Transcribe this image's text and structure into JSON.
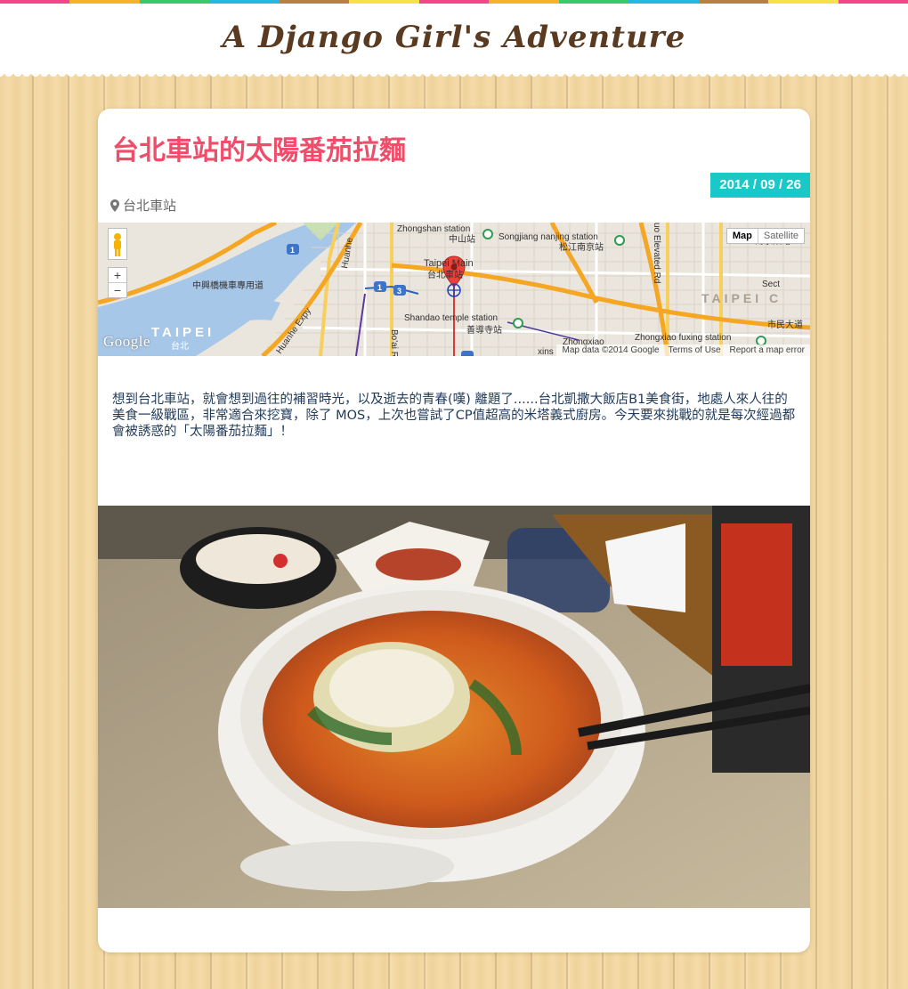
{
  "site": {
    "title": "A Django Girl's Adventure",
    "rainbow_colors": [
      "#f0478a",
      "#f8b12a",
      "#3ac96b",
      "#27b6e2",
      "#b98046",
      "#f7e04a",
      "#f0478a",
      "#f8b12a",
      "#3ac96b",
      "#27b6e2",
      "#b98046",
      "#f7e04a",
      "#f0478a"
    ]
  },
  "post": {
    "title": "台北車站的太陽番茄拉麵",
    "date": "2014 / 09 / 26",
    "location": "台北車站",
    "body": "想到台北車站，就會想到過往的補習時光，以及逝去的青春(嘆) 離題了......台北凱撒大飯店B1美食街，地處人來人往的美食一級戰區，非常適合來挖寶，除了 MOS，上次也嘗試了CP值超高的米塔義式廚房。今天要來挑戰的就是每次經過都會被誘惑的「太陽番茄拉麵」！",
    "title_color": "#f04d6a",
    "date_color": "#1bc8c8"
  },
  "map": {
    "type_map": "Map",
    "type_satellite": "Satellite",
    "zoom_in": "+",
    "zoom_out": "−",
    "logo": "Google",
    "attribution": "Map data ©2014 Google",
    "terms": "Terms of Use",
    "report": "Report a map error",
    "labels": {
      "zhongshan_en": "Zhongshan station",
      "zhongshan_zh": "中山站",
      "songjiang_en": "Songjiang nanjing station",
      "songjiang_zh": "松江南京站",
      "taipei_main_en": "Taipei Main",
      "taipei_main_zh": "台北車站",
      "shandao_en": "Shandao temple station",
      "shandao_zh": "善導寺站",
      "zhongxiao_en": "Zhongxiao fuxing station",
      "zhongxiao_short": "Zhongxiao",
      "taipei_big": "TAIPEI",
      "taipei_right": "TAIPEI C",
      "taipei_zh": "台北",
      "huanhe": "Huanhe",
      "huanhe_expy": "Huanhe Expy",
      "zhongxing_bridge": "中興橋機車專用道",
      "boai": "Bo'ai Rd",
      "elevated": "uo Elevated Rd",
      "sect": "Sect",
      "civic": "市民大道",
      "nanjing": "南京東路",
      "xins": "xins"
    }
  },
  "photo": {
    "alt": "tomato ramen"
  }
}
